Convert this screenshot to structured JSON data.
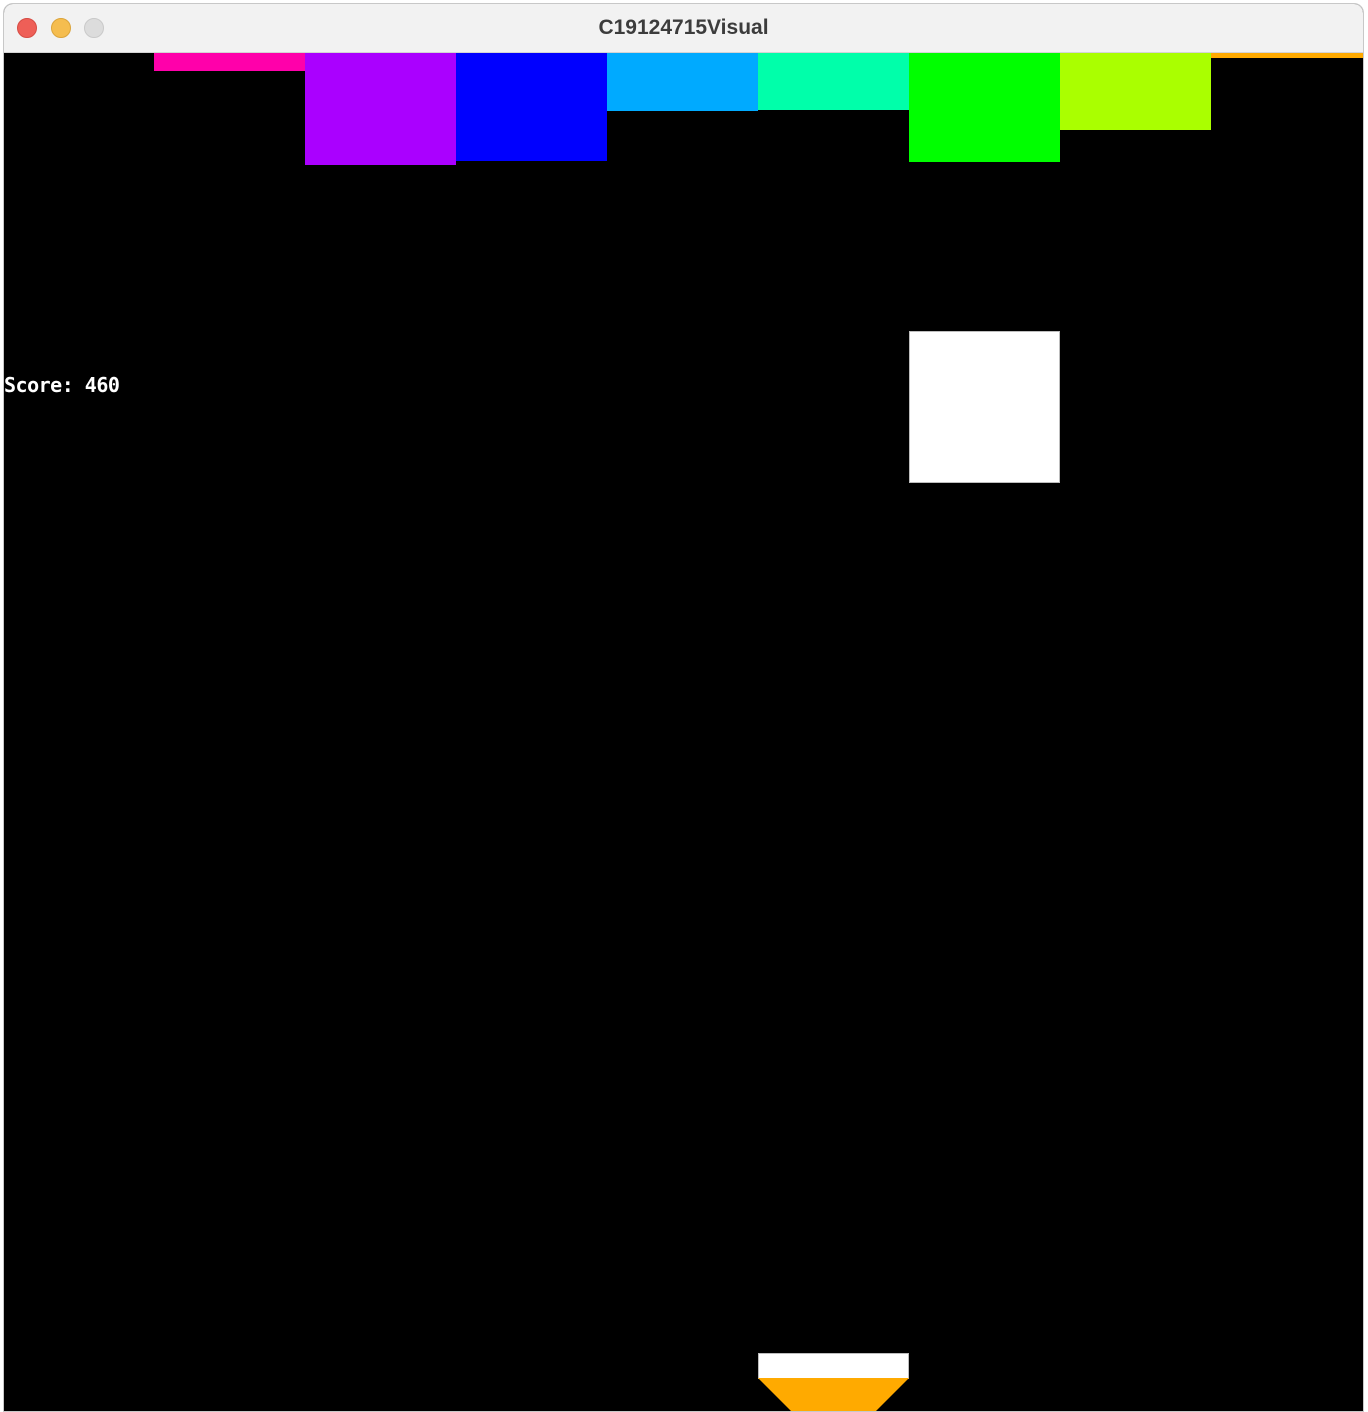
{
  "window": {
    "title": "C19124715Visual",
    "buttons": [
      "close",
      "minimize",
      "zoom"
    ]
  },
  "game": {
    "score_text": "Score: 460",
    "background": "#000000",
    "bricks": [
      {
        "color": "#ff00aa"
      },
      {
        "color": "#aa00ff"
      },
      {
        "color": "#0000ff"
      },
      {
        "color": "#00aaff"
      },
      {
        "color": "#00ffaa"
      },
      {
        "color": "#00ff00"
      },
      {
        "color": "#aaff00"
      },
      {
        "color": "#ffaa00"
      }
    ],
    "ball_color": "#ffffff",
    "paddle_color": "#ffffff",
    "paddle_base_color": "#ffaa00"
  }
}
